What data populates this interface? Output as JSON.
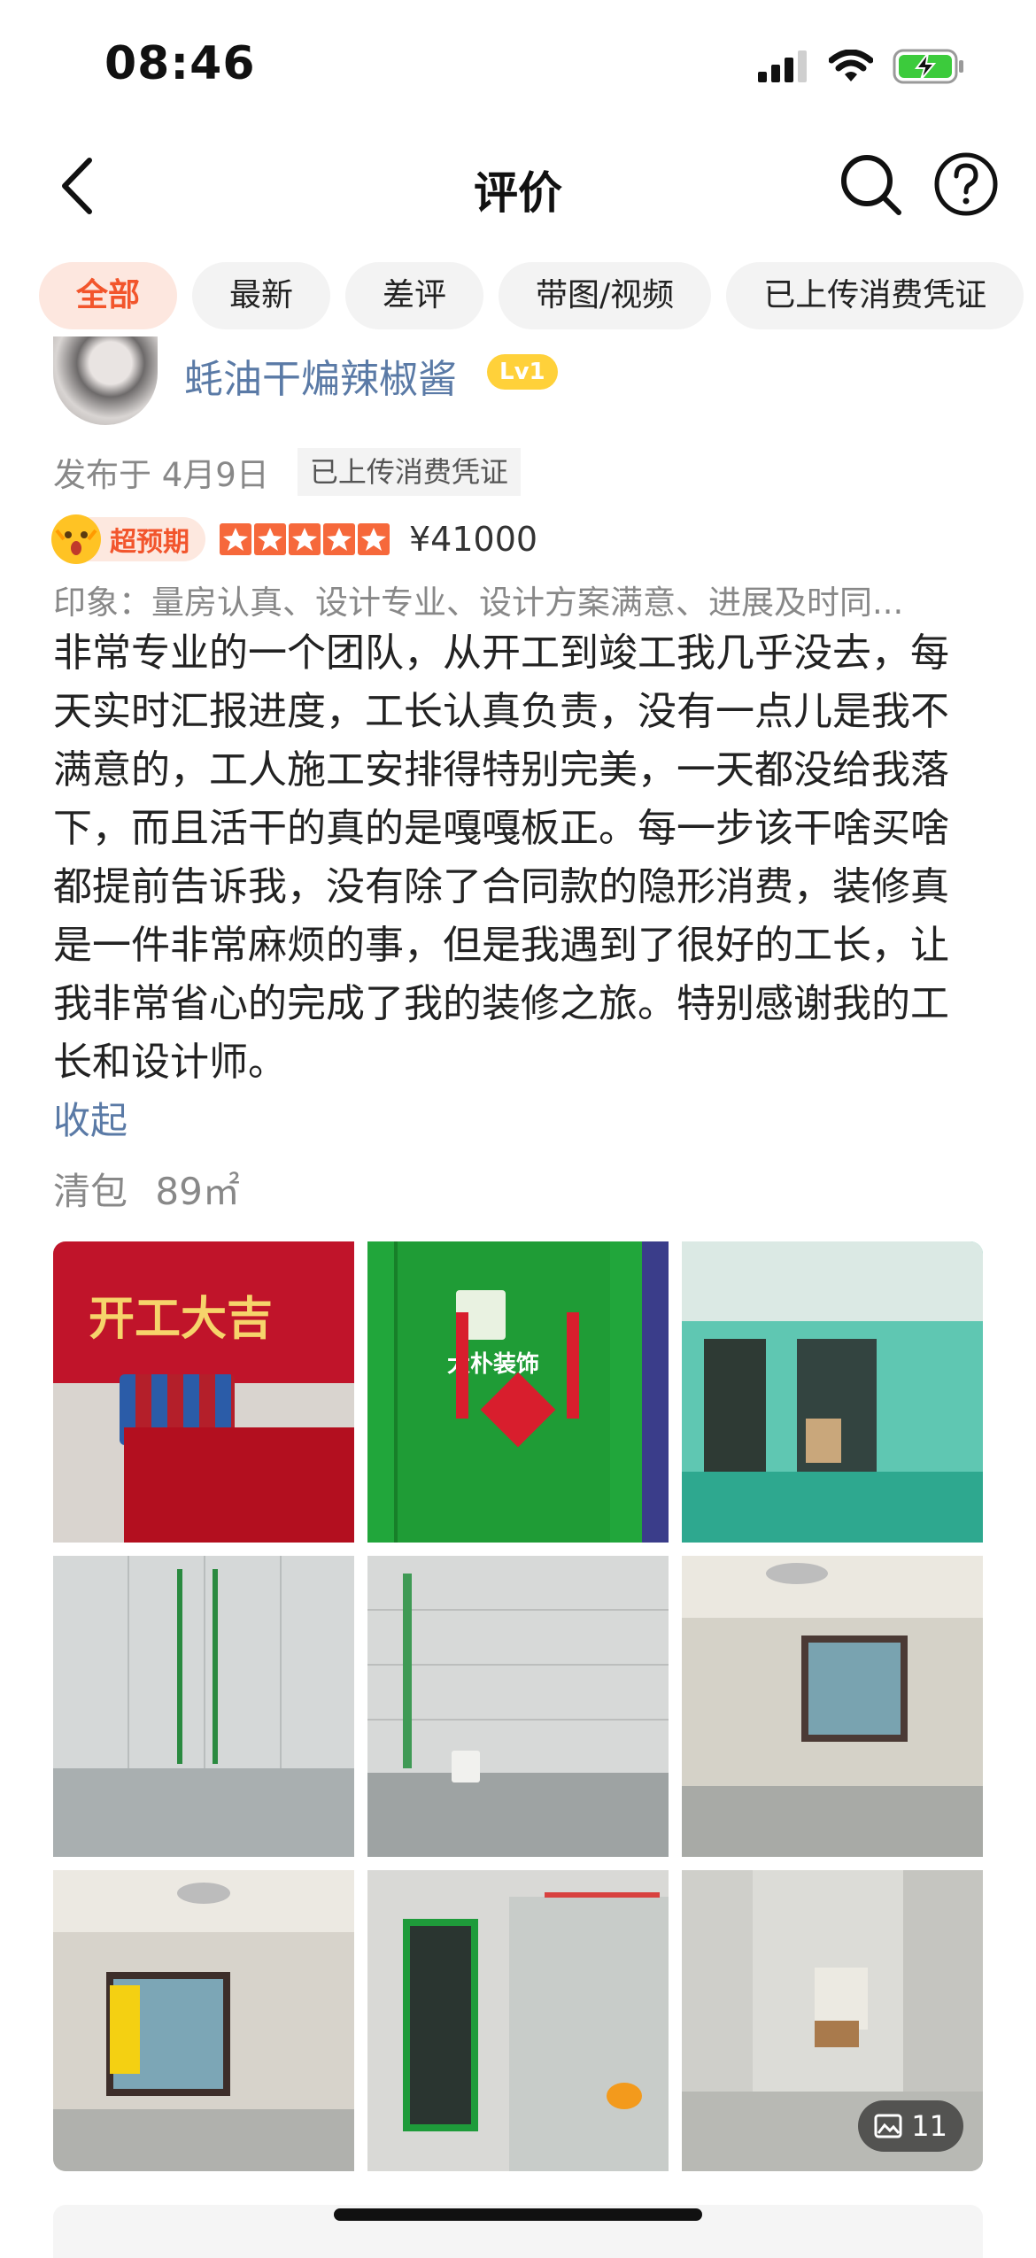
{
  "status_bar": {
    "time": "08:46"
  },
  "nav": {
    "title": "评价"
  },
  "filters": [
    {
      "label": "全部",
      "active": true
    },
    {
      "label": "最新",
      "active": false
    },
    {
      "label": "差评",
      "active": false
    },
    {
      "label": "带图/视频",
      "active": false
    },
    {
      "label": "已上传消费凭证",
      "active": false
    }
  ],
  "review": {
    "username": "蚝油干煸辣椒酱",
    "level": "Lv1",
    "publish_date": "发布于 4月9日",
    "receipt_tag": "已上传消费凭证",
    "satisfaction_badge": "超预期",
    "rating": 5,
    "price": "¥41000",
    "impression": "印象：量房认真、设计专业、设计方案满意、进展及时同...",
    "text": "非常专业的一个团队，从开工到竣工我几乎没去，每天实时汇报进度，工长认真负责，没有一点儿是我不满意的，工人施工安排得特别完美，一天都没给我落下，而且活干的真的是嘎嘎板正。每一步该干啥买啥都提前告诉我，没有除了合同款的隐形消费，装修真是一件非常麻烦的事，但是我遇到了很好的工长，让我非常省心的完成了我的装修之旅。特别感谢我的工长和设计师。",
    "collapse_label": "收起",
    "project_type": "清包",
    "area": "89㎡",
    "photo_count": "11"
  },
  "photos": [
    {
      "name": "photo-opening-ceremony",
      "signage": "开工大吉"
    },
    {
      "name": "photo-green-door",
      "signage": "大朴装饰"
    },
    {
      "name": "photo-empty-room-door"
    },
    {
      "name": "photo-tiled-bathroom"
    },
    {
      "name": "photo-bathroom-bucket"
    },
    {
      "name": "photo-bedroom-window"
    },
    {
      "name": "photo-room-window-poster"
    },
    {
      "name": "photo-doorway-plumbing"
    },
    {
      "name": "photo-hallway"
    }
  ]
}
